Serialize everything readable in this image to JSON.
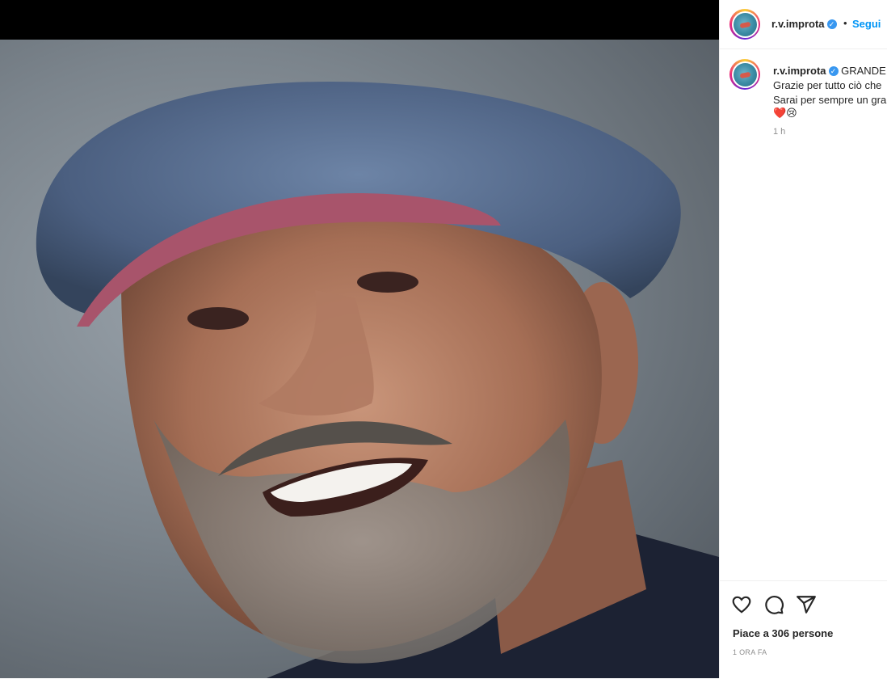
{
  "post": {
    "username": "r.v.improta",
    "verified_icon": "verified-badge-icon",
    "separator": "•",
    "follow_label": "Segui"
  },
  "caption": {
    "username": "r.v.improta",
    "line1": "GRANDE",
    "line2": "Grazie per tutto ciò che",
    "line3": "Sarai per sempre un gra",
    "emojis": "❤️😢",
    "time": "1 h"
  },
  "footer": {
    "likes": "Piace a 306 persone",
    "time_ago": "1 ORA FA",
    "icons": [
      "heart-icon",
      "comment-icon",
      "share-icon"
    ]
  },
  "colors": {
    "accent": "#0095f6",
    "verified": "#3897f0"
  }
}
